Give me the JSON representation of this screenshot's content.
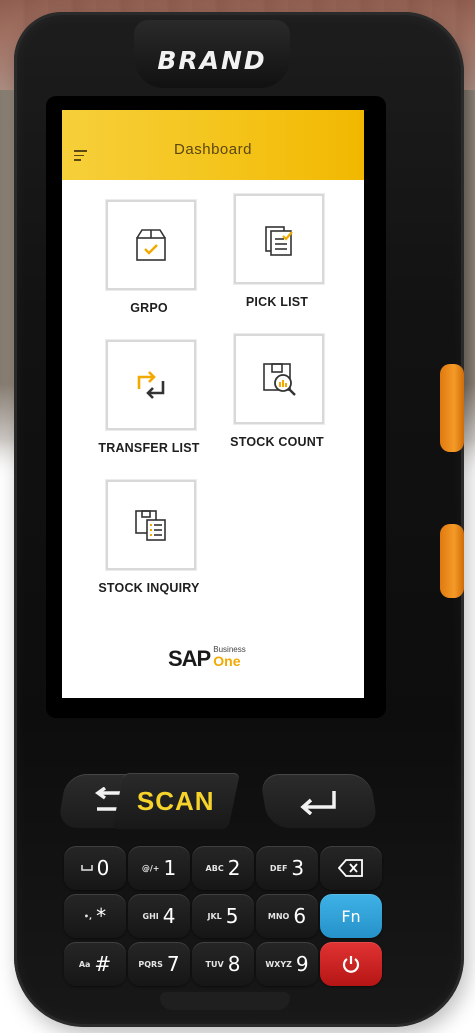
{
  "device": {
    "brand": "BRAND"
  },
  "app": {
    "title": "Dashboard",
    "tiles": [
      {
        "label": "GRPO",
        "icon": "package-check-icon"
      },
      {
        "label": "PICK LIST",
        "icon": "document-check-icon"
      },
      {
        "label": "TRANSFER LIST",
        "icon": "transfer-arrows-icon"
      },
      {
        "label": "STOCK COUNT",
        "icon": "box-search-icon"
      },
      {
        "label": "STOCK INQUIRY",
        "icon": "documents-list-icon"
      }
    ],
    "footer_logo": {
      "sap": "SAP",
      "business": "Business",
      "one": "One"
    }
  },
  "keypad": {
    "scan_label": "SCAN",
    "keys": [
      {
        "sub": "",
        "main": "0"
      },
      {
        "sub": "@/+",
        "main": "1"
      },
      {
        "sub": "ABC",
        "main": "2"
      },
      {
        "sub": "DEF",
        "main": "3"
      },
      {
        "sub": "",
        "main": ""
      },
      {
        "sub": "•,",
        "main": "*"
      },
      {
        "sub": "GHI",
        "main": "4"
      },
      {
        "sub": "JKL",
        "main": "5"
      },
      {
        "sub": "MNO",
        "main": "6"
      },
      {
        "sub": "",
        "main": "Fn"
      },
      {
        "sub": "Aa",
        "main": "#"
      },
      {
        "sub": "PQRS",
        "main": "7"
      },
      {
        "sub": "TUV",
        "main": "8"
      },
      {
        "sub": "WXYZ",
        "main": "9"
      },
      {
        "sub": "",
        "main": ""
      }
    ]
  },
  "colors": {
    "header_yellow": "#f4c318",
    "accent_orange": "#f2a900",
    "fn_blue": "#2592c9",
    "power_red": "#d42020",
    "scan_yellow": "#f5d32a"
  }
}
